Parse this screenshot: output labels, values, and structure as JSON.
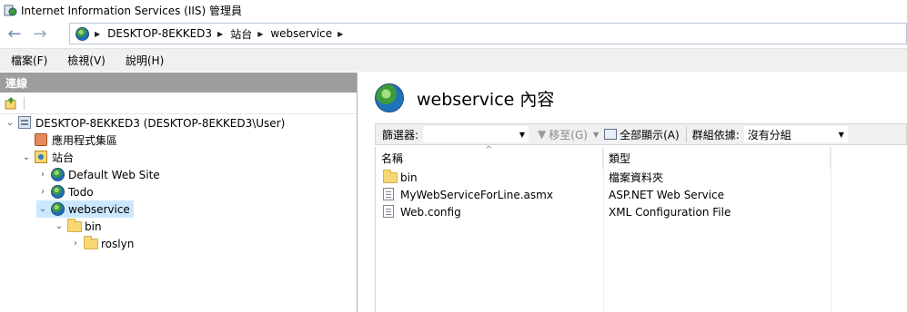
{
  "window": {
    "title": "Internet Information Services (IIS) 管理員"
  },
  "address": {
    "segments": [
      "DESKTOP-8EKKED3",
      "站台",
      "webservice"
    ]
  },
  "menu": {
    "items": [
      "檔案(F)",
      "檢視(V)",
      "說明(H)"
    ]
  },
  "connections": {
    "header": "連線",
    "tree": [
      {
        "label": "DESKTOP-8EKKED3 (DESKTOP-8EKKED3\\User)",
        "icon": "server-icon",
        "expanded": true
      },
      {
        "label": "應用程式集區",
        "icon": "app-pool-icon"
      },
      {
        "label": "站台",
        "icon": "sites-icon",
        "expanded": true
      },
      {
        "label": "Default Web Site",
        "icon": "globe-icon",
        "expanded": false
      },
      {
        "label": "Todo",
        "icon": "globe-icon",
        "expanded": false
      },
      {
        "label": "webservice",
        "icon": "globe-icon",
        "expanded": true,
        "selected": true
      },
      {
        "label": "bin",
        "icon": "folder-icon",
        "expanded": true
      },
      {
        "label": "roslyn",
        "icon": "folder-icon",
        "expanded": false
      }
    ]
  },
  "content": {
    "title": "webservice 內容",
    "filter_label": "篩選器:",
    "go_label": "移至(G)",
    "show_all_label": "全部顯示(A)",
    "group_by_label": "群組依據:",
    "group_by_value": "沒有分組",
    "columns": {
      "name": "名稱",
      "type": "類型"
    },
    "rows": [
      {
        "name": "bin",
        "type": "檔案資料夾",
        "icon": "folder-icon"
      },
      {
        "name": "MyWebServiceForLine.asmx",
        "type": "ASP.NET Web Service",
        "icon": "asmx-file-icon"
      },
      {
        "name": "Web.config",
        "type": "XML Configuration File",
        "icon": "config-file-icon"
      }
    ]
  }
}
